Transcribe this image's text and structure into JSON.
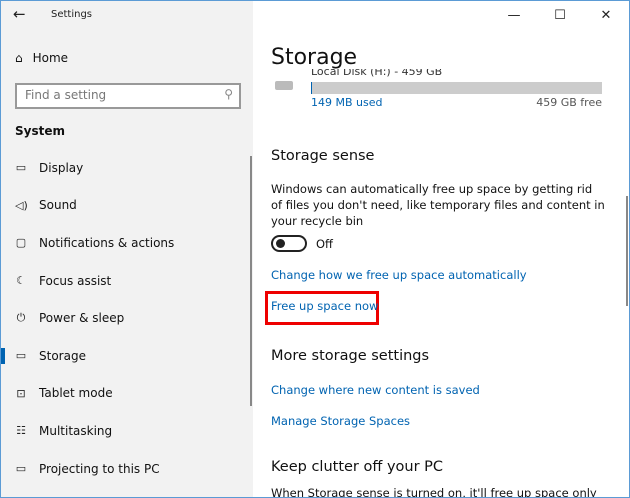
{
  "window": {
    "title": "Settings",
    "controls": [
      "—",
      "☐",
      "✕"
    ]
  },
  "sidebar": {
    "home": "Home",
    "search_placeholder": "Find a setting",
    "section": "System",
    "items": [
      {
        "label": "Display",
        "icon": "▭"
      },
      {
        "label": "Sound",
        "icon": "◁)"
      },
      {
        "label": "Notifications & actions",
        "icon": "▢"
      },
      {
        "label": "Focus assist",
        "icon": "☾"
      },
      {
        "label": "Power & sleep",
        "icon": "⏻"
      },
      {
        "label": "Storage",
        "icon": "▭"
      },
      {
        "label": "Tablet mode",
        "icon": "⊡"
      },
      {
        "label": "Multitasking",
        "icon": "☷"
      },
      {
        "label": "Projecting to this PC",
        "icon": "▭"
      }
    ]
  },
  "main": {
    "title": "Storage",
    "disk": {
      "name": "Local Disk (H:) - 459 GB",
      "used": "149 MB used",
      "free": "459 GB free",
      "used_fraction": 0.0003
    },
    "storage_sense": {
      "heading": "Storage sense",
      "desc": "Windows can automatically free up space by getting rid of files you don't need, like temporary files and content in your recycle bin",
      "toggle": "Off",
      "link1": "Change how we free up space automatically",
      "link2": "Free up space now"
    },
    "more": {
      "heading": "More storage settings",
      "link1": "Change where new content is saved",
      "link2": "Manage Storage Spaces"
    },
    "clutter": {
      "heading": "Keep clutter off your PC",
      "desc": "When Storage sense is turned on, it'll free up space only when"
    }
  },
  "colors": {
    "accent": "#0063b1",
    "highlight": "#e00000"
  }
}
